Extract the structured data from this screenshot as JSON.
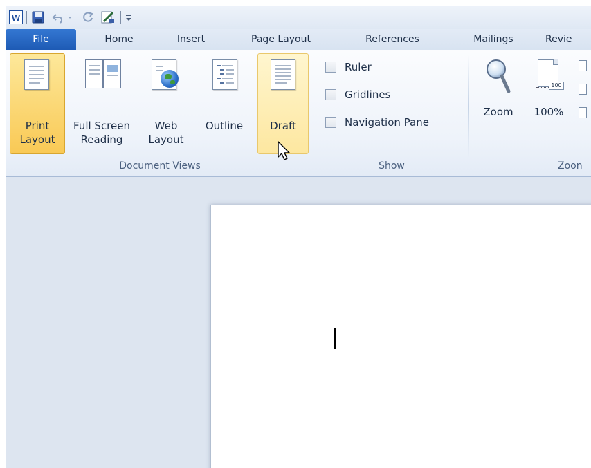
{
  "qat": {
    "icons": [
      "word-icon",
      "save-icon",
      "undo-icon",
      "redo-icon",
      "print-preview-icon",
      "customize-qat-icon"
    ],
    "app_letter": "W"
  },
  "tabs": [
    {
      "label": "File",
      "selected": true
    },
    {
      "label": "Home"
    },
    {
      "label": "Insert"
    },
    {
      "label": "Page Layout"
    },
    {
      "label": "References"
    },
    {
      "label": "Mailings"
    },
    {
      "label": "Revie"
    }
  ],
  "document_views": {
    "group_label": "Document Views",
    "print_layout": {
      "line1": "Print",
      "line2": "Layout",
      "state": "active"
    },
    "full_screen_reading": {
      "line1": "Full Screen",
      "line2": "Reading"
    },
    "web_layout": {
      "line1": "Web",
      "line2": "Layout"
    },
    "outline": {
      "line1": "Outline"
    },
    "draft": {
      "line1": "Draft",
      "state": "hover"
    }
  },
  "show": {
    "group_label": "Show",
    "ruler": "Ruler",
    "gridlines": "Gridlines",
    "navigation_pane": "Navigation Pane"
  },
  "zoom": {
    "group_label": "Zoon",
    "zoom_label": "Zoom",
    "percent_label": "100%",
    "percent_badge": "100"
  },
  "colors": {
    "file_tab": "#2a6ac7",
    "active_button": "#f9c955",
    "hover_button": "#fde7a0",
    "ribbon_bg": "#eef3fa",
    "workspace_bg": "#dde5f0"
  }
}
